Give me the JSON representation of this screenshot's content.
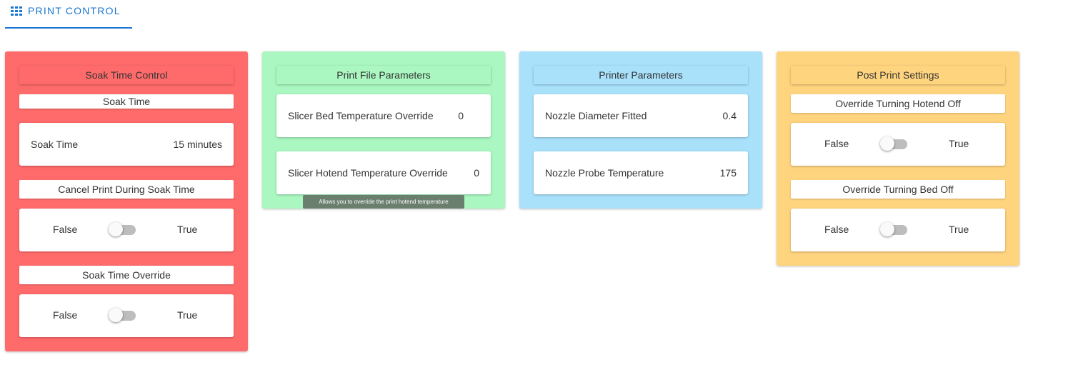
{
  "tab": {
    "label": "PRINT CONTROL",
    "icon": "grid-icon",
    "accent": "#1976d2"
  },
  "cards": {
    "soak": {
      "color": "#ff6b6b",
      "header_color": "#ff6b6b",
      "title": "Soak Time Control",
      "soak_time_label": "Soak Time",
      "soak_time_row": {
        "label": "Soak Time",
        "value": "15 minutes"
      },
      "cancel_label": "Cancel Print During Soak Time",
      "cancel_toggle": {
        "false_label": "False",
        "true_label": "True",
        "on": false
      },
      "override_label": "Soak Time Override",
      "override_toggle": {
        "false_label": "False",
        "true_label": "True",
        "on": false
      }
    },
    "printfile": {
      "color": "#aaf7c1",
      "title": "Print File Parameters",
      "bed_row": {
        "label": "Slicer Bed Temperature Override",
        "value": "0"
      },
      "hotend_row": {
        "label": "Slicer Hotend Temperature Override",
        "value": "0"
      },
      "tooltip": "Allows you to override the print hotend temperature"
    },
    "printer": {
      "color": "#a9e1fb",
      "title": "Printer Parameters",
      "nozzle_row": {
        "label": "Nozzle Diameter Fitted",
        "value": "0.4"
      },
      "probe_row": {
        "label": "Nozzle Probe Temperature",
        "value": "175"
      }
    },
    "postprint": {
      "color": "#ffd47f",
      "title": "Post Print Settings",
      "hotend_label": "Override Turning Hotend Off",
      "hotend_toggle": {
        "false_label": "False",
        "true_label": "True",
        "on": false
      },
      "bed_label": "Override Turning Bed Off",
      "bed_toggle": {
        "false_label": "False",
        "true_label": "True",
        "on": false
      }
    }
  }
}
